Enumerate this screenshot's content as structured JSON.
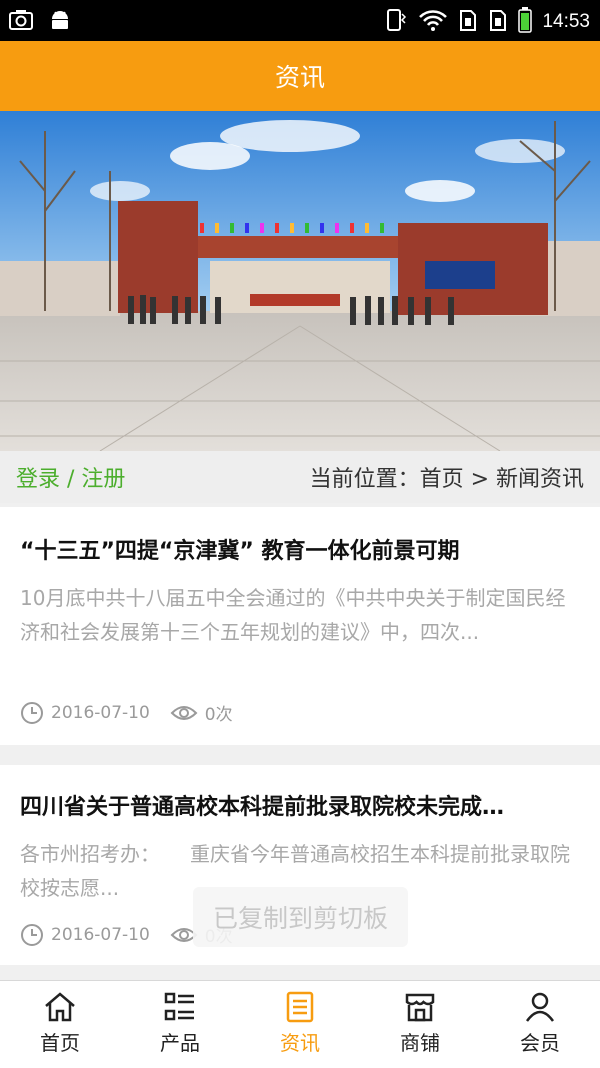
{
  "status_bar": {
    "time": "14:53",
    "left_icons": [
      "screenshot-icon",
      "android-icon"
    ],
    "right_icons": [
      "phone-vibrate-icon",
      "wifi-icon",
      "sim1-icon",
      "sim2-icon",
      "battery-icon"
    ]
  },
  "header": {
    "title": "资讯"
  },
  "banner": {
    "image": "school-gate-photo"
  },
  "breadcrumb_bar": {
    "login_register": "登录 / 注册",
    "location": "当前位置：首页 > 新闻资讯"
  },
  "articles": [
    {
      "title": "“十三五”四提“京津冀” 教育一体化前景可期",
      "summary": "10月底中共十八届五中全会通过的《中共中央关于制定国民经济和社会发展第十三个五年规划的建议》中，四次...",
      "date": "2016-07-10",
      "views": "0次"
    },
    {
      "title": "四川省关于普通高校本科提前批录取院校未完成…",
      "summary": "各市州招考办：　　重庆省今年普通高校招生本科提前批录取院校按志愿...",
      "date": "2016-07-10",
      "views": "0次"
    }
  ],
  "toast": "已复制到剪切板",
  "bottom_nav": {
    "active": "资讯",
    "items": [
      {
        "label": "首页",
        "icon": "home-icon"
      },
      {
        "label": "产品",
        "icon": "grid-list-icon"
      },
      {
        "label": "资讯",
        "icon": "news-icon"
      },
      {
        "label": "商铺",
        "icon": "store-icon"
      },
      {
        "label": "会员",
        "icon": "user-icon"
      }
    ]
  },
  "colors": {
    "accent": "#f79c10",
    "login_green": "#4cae2d"
  }
}
